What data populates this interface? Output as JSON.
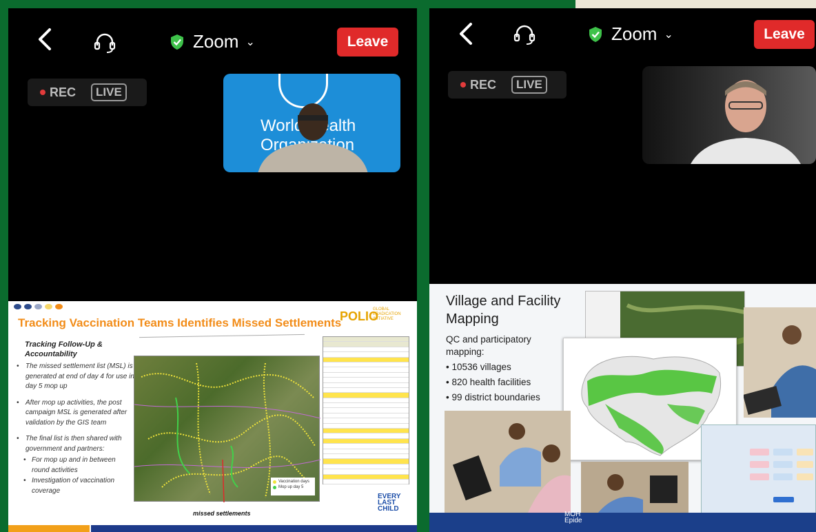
{
  "left": {
    "meeting_name": "Zoom",
    "leave_label": "Leave",
    "rec_label": "REC",
    "live_label": "LIVE",
    "thumb_text_1": "World Health",
    "thumb_text_2": "Organization",
    "slide": {
      "title": "Tracking Vaccination Teams Identifies Missed Settlements",
      "logo": "POLIO",
      "logo_sub": "GLOBAL ERADICATION INITIATIVE",
      "heading": "Tracking Follow-Up & Accountability",
      "bullets": [
        "The missed settlement list (MSL) is generated at end of day 4 for use in day 5 mop up",
        "After mop up activities, the post campaign MSL is generated after validation by the GIS team",
        "The final  list is then shared with government and partners:"
      ],
      "sub_bullets": [
        "For mop up and in between round activities",
        "Investigation of vaccination coverage"
      ],
      "legend": [
        "Vaccination days",
        "Mop up day 5"
      ],
      "map_caption": "missed settlements",
      "brand": "EVERY LAST CHILD"
    }
  },
  "right": {
    "meeting_name": "Zoom",
    "leave_label": "Leave",
    "rec_label": "REC",
    "live_label": "LIVE",
    "slide": {
      "title": "Village and Facility Mapping",
      "subtitle": "QC and participatory mapping:",
      "bullets": [
        "• 10536 villages",
        "• 820 health facilities",
        "• 99 district boundaries"
      ],
      "footer_text": "MOH Epide"
    }
  },
  "colors": {
    "background": "#0b6b2e",
    "leave": "#e02a2a",
    "shield": "#3ec24a",
    "slide_title": "#f28c18",
    "who_blue": "#1d8ed8"
  }
}
